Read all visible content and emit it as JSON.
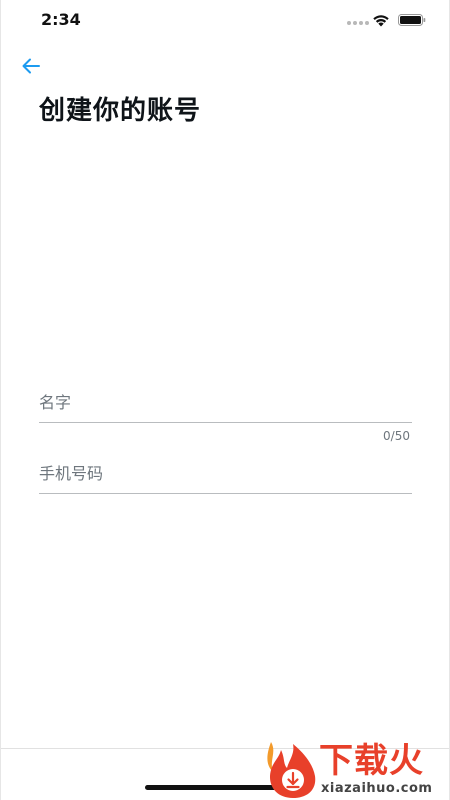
{
  "status_bar": {
    "time": "2:34"
  },
  "header": {
    "back_icon": "arrow-left-icon",
    "title": "创建你的账号"
  },
  "form": {
    "name": {
      "placeholder": "名字",
      "value": "",
      "counter": "0/50"
    },
    "phone": {
      "placeholder": "手机号码",
      "value": ""
    }
  },
  "watermark": {
    "brand": "下载火",
    "url": "xiazaihuo.com"
  },
  "colors": {
    "accent": "#1d9bf0",
    "text": "#0f1419",
    "placeholder": "#6e767d",
    "watermark": "#e8402a"
  }
}
